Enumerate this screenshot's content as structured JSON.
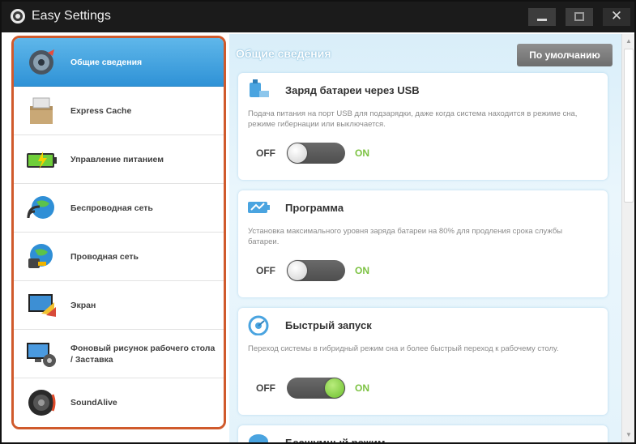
{
  "window": {
    "title": "Easy Settings",
    "minimize_icon": "minimize-icon",
    "maximize_icon": "maximize-icon",
    "close_glyph": "✕"
  },
  "sidebar": {
    "items": [
      {
        "label": "Общие сведения",
        "icon": "gear-icon",
        "active": true
      },
      {
        "label": "Express Cache",
        "icon": "cache-box-icon",
        "active": false
      },
      {
        "label": "Управление питанием",
        "icon": "battery-icon",
        "active": false
      },
      {
        "label": "Беспроводная сеть",
        "icon": "wireless-globe-icon",
        "active": false
      },
      {
        "label": "Проводная сеть",
        "icon": "wired-network-icon",
        "active": false
      },
      {
        "label": "Экран",
        "icon": "display-icon",
        "active": false
      },
      {
        "label": "Фоновый рисунок рабочего стола / Заставка",
        "icon": "wallpaper-icon",
        "active": false
      },
      {
        "label": "SoundAlive",
        "icon": "speaker-icon",
        "active": false
      }
    ]
  },
  "main": {
    "section_title": "Общие сведения",
    "default_button": "По умолчанию",
    "cards": [
      {
        "title": "Заряд батареи через USB",
        "description": "Подача питания на порт USB для подзарядки, даже когда система находится в режиме сна, режиме гибернации или выключается.",
        "off_label": "OFF",
        "on_label": "ON",
        "state": "off",
        "icon": "usb-charge-icon"
      },
      {
        "title": "Программа",
        "description": "Установка максимального уровня заряда батареи на 80% для продления срока службы батареи.",
        "off_label": "OFF",
        "on_label": "ON",
        "state": "off",
        "icon": "battery-program-icon"
      },
      {
        "title": "Быстрый запуск",
        "description": "Переход системы в гибридный режим сна и более быстрый переход к рабочему столу.",
        "off_label": "OFF",
        "on_label": "ON",
        "state": "on",
        "icon": "fast-boot-icon"
      },
      {
        "title": "Бесшумный режим",
        "icon": "silent-mode-icon"
      }
    ]
  },
  "colors": {
    "accent_blue": "#2f92d6",
    "sidebar_border": "#d05a2c",
    "on_green": "#7cc242",
    "titlebar": "#1b1b1b"
  }
}
